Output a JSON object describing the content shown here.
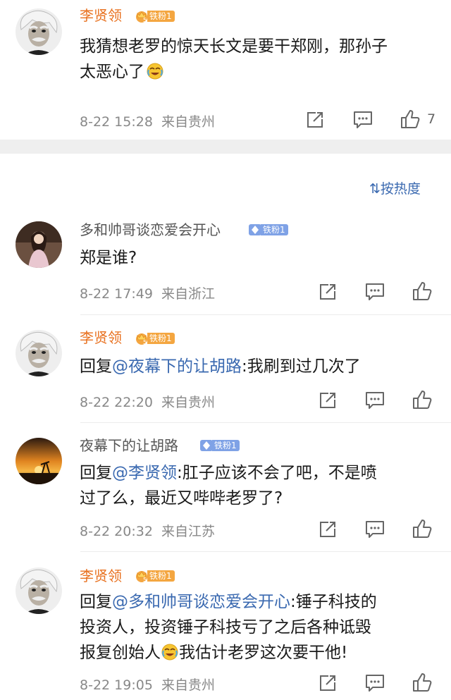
{
  "main_post": {
    "user": "李贤领",
    "badge": {
      "level": "5",
      "label": "铁粉1"
    },
    "text_line1": "我猜想老罗的惊天长文是要干郑刚，那孙子",
    "text_line2": "太恶心了",
    "time": "8-22 15:28",
    "source": "来自贵州",
    "like_count": "7"
  },
  "sort": {
    "label": "按热度"
  },
  "comments": [
    {
      "user": "多和帅哥谈恋爱会开心",
      "badge": "铁粉1",
      "text": "郑是谁?",
      "time": "8-22 17:49",
      "source": "来自浙江"
    },
    {
      "user": "李贤领",
      "badge": "铁粉1",
      "reply_prefix": "回复",
      "mention": "@夜幕下的让胡路",
      "text": ":我刷到过几次了",
      "time": "8-22 22:20",
      "source": "来自贵州"
    },
    {
      "user": "夜幕下的让胡路",
      "badge": "铁粉1",
      "reply_prefix": "回复",
      "mention": "@李贤领",
      "text_line1": ":肛子应该不会了吧，不是喷",
      "text_line2": "过了么，最近又哔哔老罗了?",
      "time": "8-22 20:32",
      "source": "来自江苏"
    },
    {
      "user": "李贤领",
      "badge": "铁粉1",
      "reply_prefix": "回复",
      "mention": "@多和帅哥谈恋爱会开心",
      "text_line1": ":锤子科技的",
      "text_line2": "投资人，投资锤子科技亏了之后各种诋毁",
      "text_line3a": "报复创始人",
      "text_line3b": "我估计老罗这次要干他!",
      "time": "8-22 19:05",
      "source": "来自贵州"
    }
  ],
  "colors": {
    "username_orange": "#e8701e",
    "link_blue": "#3a69b0",
    "meta_gray": "#888888"
  }
}
